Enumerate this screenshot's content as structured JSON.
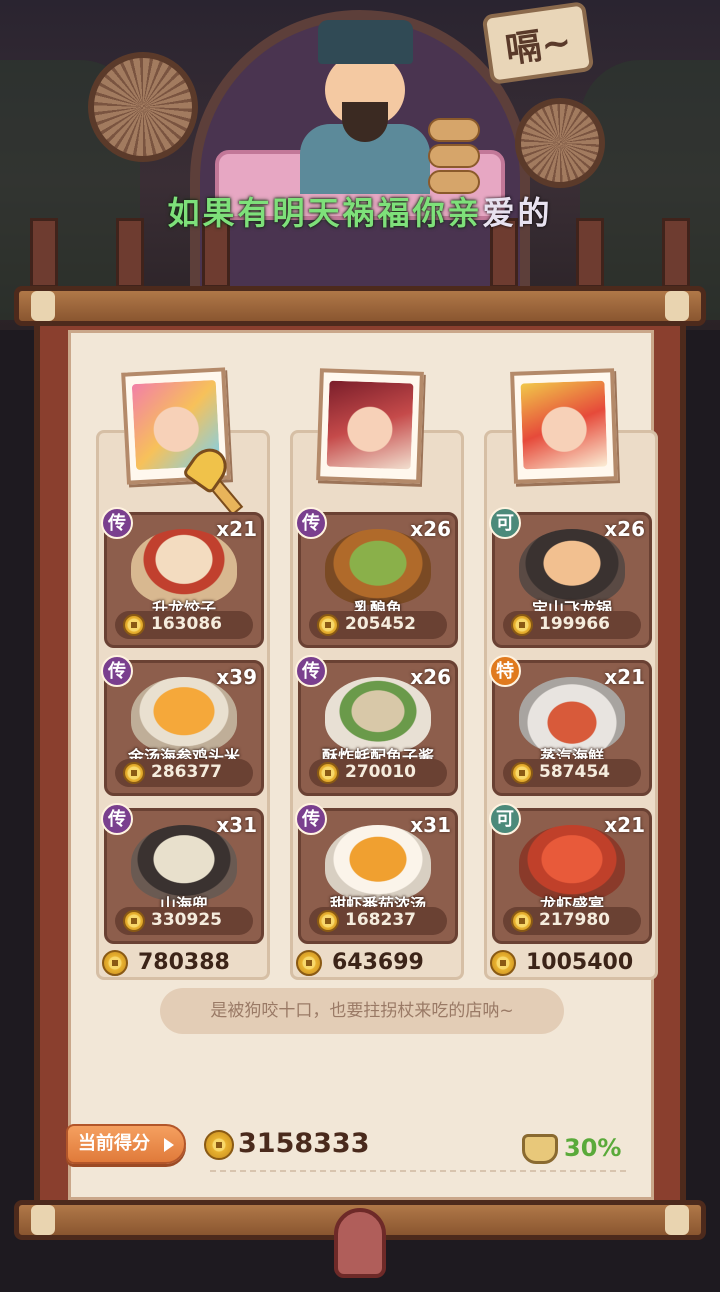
{
  "header": {
    "speech_bubble": "嗝~",
    "subtitle_highlight": "如果有明天祸福你亲",
    "subtitle_rest": "爱的"
  },
  "columns": [
    {
      "rows": [
        {
          "rarity": "传",
          "count": "x21",
          "name": "升龙饺子",
          "price": "163086"
        },
        {
          "rarity": "传",
          "count": "x39",
          "name": "金汤海参鸡头米",
          "price": "286377"
        },
        {
          "rarity": "传",
          "count": "x31",
          "name": "山海兜",
          "price": "330925"
        }
      ],
      "total": "780388"
    },
    {
      "rows": [
        {
          "rarity": "传",
          "count": "x26",
          "name": "乳酿鱼",
          "price": "205452"
        },
        {
          "rarity": "传",
          "count": "x26",
          "name": "酥炸蚝配鱼子酱",
          "price": "270010"
        },
        {
          "rarity": "传",
          "count": "x31",
          "name": "甜虾番茄浓汤",
          "price": "168237"
        }
      ],
      "total": "643699"
    },
    {
      "rows": [
        {
          "rarity": "可",
          "count": "x26",
          "name": "宝山飞龙锅",
          "price": "199966"
        },
        {
          "rarity": "特",
          "count": "x21",
          "name": "蒸汽海鲜",
          "price": "587454"
        },
        {
          "rarity": "可",
          "count": "x21",
          "name": "龙虾盛宴",
          "price": "217980"
        }
      ],
      "total": "1005400"
    }
  ],
  "quote": "是被狗咬十口，也要拄拐杖来吃的店呐~",
  "footer": {
    "score_label": "当前得分",
    "score_value": "3158333",
    "bonus_percent": "30%"
  },
  "colors": {
    "rarity_chuan": "#7a3f8e",
    "rarity_ke": "#4c8a7a",
    "rarity_te": "#e07a1e",
    "subtitle_highlight": "#7ee07a",
    "bonus_green": "#5aaa3a"
  }
}
